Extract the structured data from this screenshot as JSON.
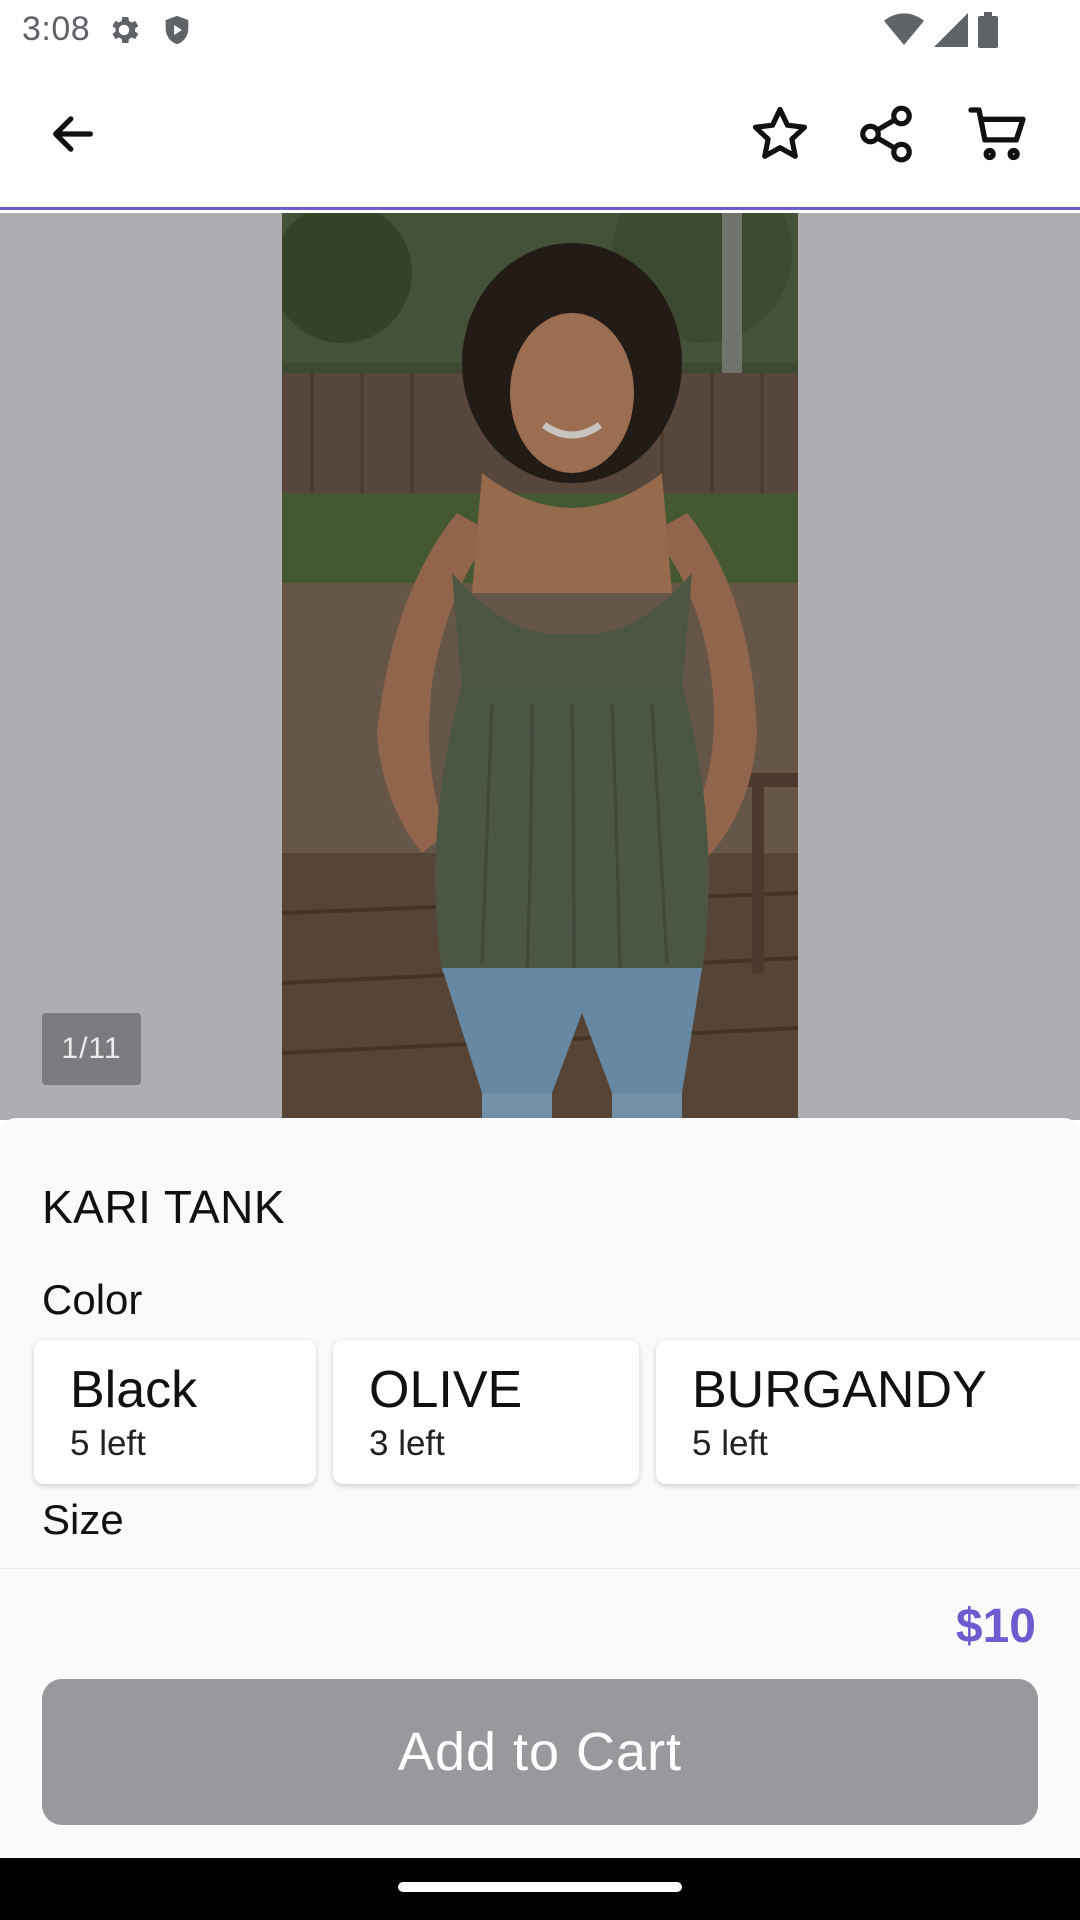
{
  "status_bar": {
    "time": "3:08",
    "icons": [
      "settings-gear-icon",
      "shield-icon",
      "wifi-icon",
      "cell-signal-icon",
      "battery-icon"
    ]
  },
  "app_bar": {
    "icons": [
      "back-arrow-icon",
      "star-icon",
      "share-icon",
      "cart-icon"
    ],
    "accent_color": "#6d5ccf"
  },
  "gallery": {
    "counter": "1/11"
  },
  "product": {
    "title": "KARI TANK",
    "color_label": "Color",
    "size_label": "Size",
    "colors": [
      {
        "name": "Black",
        "stock": "5 left"
      },
      {
        "name": "OLIVE",
        "stock": "3 left"
      },
      {
        "name": "BURGANDY",
        "stock": "5 left"
      }
    ],
    "price": "$10",
    "add_to_cart_label": "Add to Cart"
  }
}
